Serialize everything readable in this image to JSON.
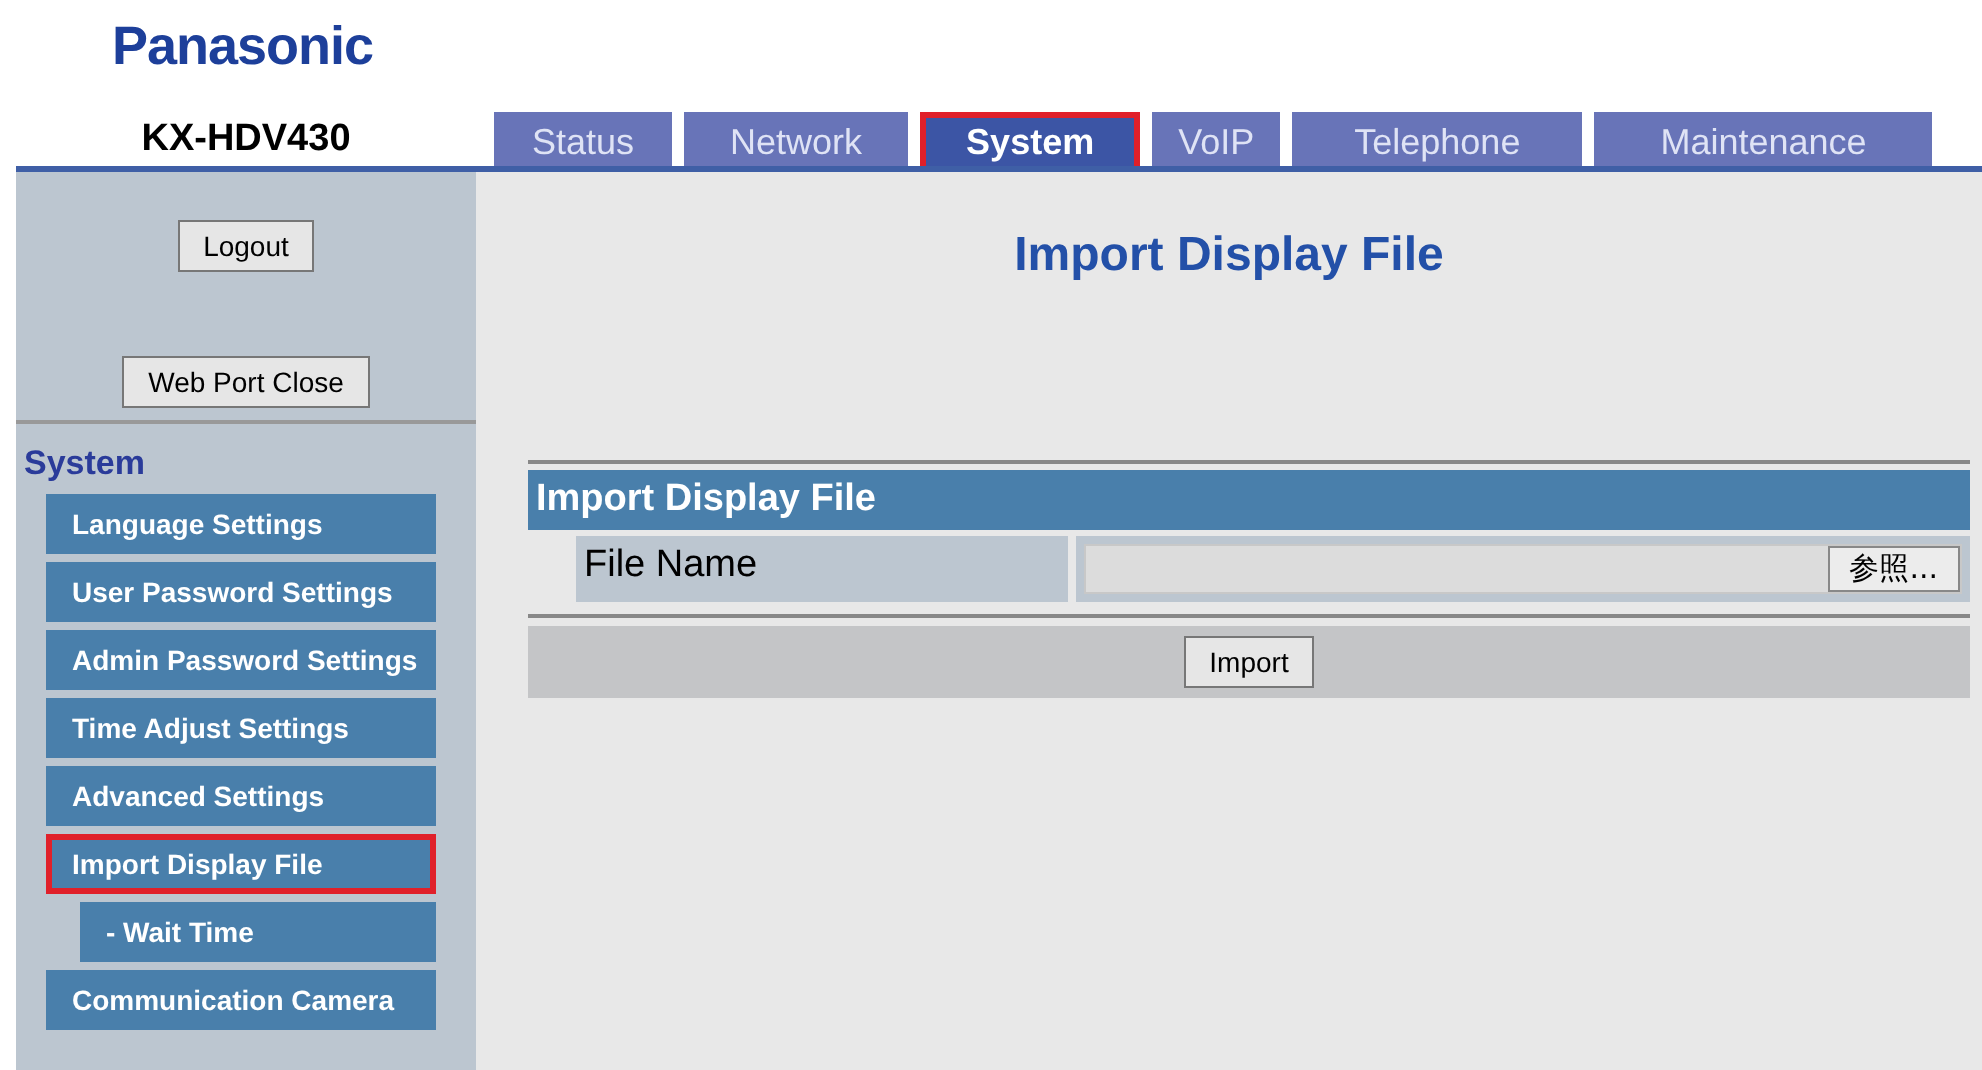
{
  "brand": "Panasonic",
  "model": "KX-HDV430",
  "tabs": [
    {
      "label": "Status",
      "selected": false,
      "highlighted": false
    },
    {
      "label": "Network",
      "selected": false,
      "highlighted": false
    },
    {
      "label": "System",
      "selected": true,
      "highlighted": true
    },
    {
      "label": "VoIP",
      "selected": false,
      "highlighted": false
    },
    {
      "label": "Telephone",
      "selected": false,
      "highlighted": false
    },
    {
      "label": "Maintenance",
      "selected": false,
      "highlighted": false
    }
  ],
  "sidebar": {
    "logout": "Logout",
    "web_port_close": "Web Port Close",
    "section": "System",
    "items": [
      {
        "label": "Language Settings",
        "highlighted": false,
        "sub": false
      },
      {
        "label": "User Password Settings",
        "highlighted": false,
        "sub": false
      },
      {
        "label": "Admin Password Settings",
        "highlighted": false,
        "sub": false
      },
      {
        "label": "Time Adjust Settings",
        "highlighted": false,
        "sub": false
      },
      {
        "label": "Advanced Settings",
        "highlighted": false,
        "sub": false
      },
      {
        "label": "Import Display File",
        "highlighted": true,
        "sub": false
      },
      {
        "label": "- Wait Time",
        "highlighted": false,
        "sub": true
      },
      {
        "label": "Communication Camera",
        "highlighted": false,
        "sub": false
      }
    ]
  },
  "page_title": "Import Display File",
  "form": {
    "header": "Import Display File",
    "file_label": "File Name",
    "browse": "参照...",
    "submit": "Import"
  }
}
